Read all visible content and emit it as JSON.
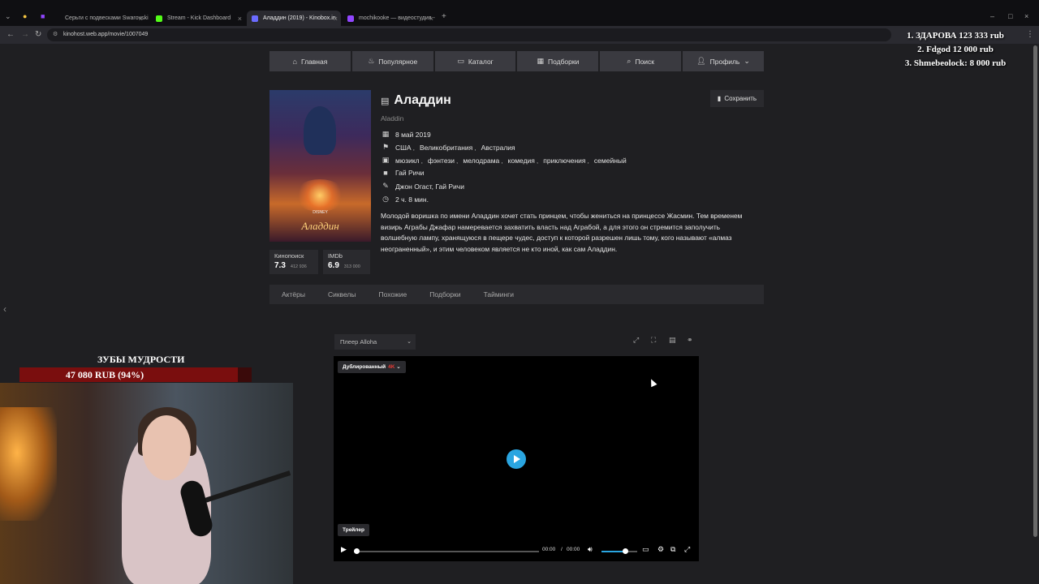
{
  "browser": {
    "tabs": [
      {
        "title": "Серьги с подвесками Swarovski",
        "color": "#4aa3e0",
        "active": false
      },
      {
        "title": "Stream - Kick Dashboard",
        "color": "#53fc18",
        "active": false
      },
      {
        "title": "Аладдин (2019) - Kinobox.in",
        "color": "#6b6bff",
        "active": true
      },
      {
        "title": "mochikooke — видеостудия -",
        "color": "#9146ff",
        "active": false
      }
    ],
    "url": "kinohost.web.app/movie/1007049"
  },
  "nav": {
    "items": [
      {
        "label": "Главная",
        "icon": "home-icon"
      },
      {
        "label": "Популярное",
        "icon": "fire-icon"
      },
      {
        "label": "Каталог",
        "icon": "catalog-icon"
      },
      {
        "label": "Подборки",
        "icon": "collections-icon"
      },
      {
        "label": "Поиск",
        "icon": "search-icon"
      },
      {
        "label": "Профиль",
        "icon": "user-icon"
      }
    ]
  },
  "movie": {
    "title": "Аладдин",
    "original_title": "Aladdin",
    "save_label": "Сохранить",
    "release_date": "8 май 2019",
    "countries": [
      "США",
      "Великобритания",
      "Австралия"
    ],
    "genres": [
      "мюзикл",
      "фэнтези",
      "мелодрама",
      "комедия",
      "приключения",
      "семейный"
    ],
    "director": "Гай Ричи",
    "writers": "Джон Огаст, Гай Ричи",
    "duration": "2 ч. 8 мин.",
    "description": "Молодой воришка по имени Аладдин хочет стать принцем, чтобы жениться на принцессе Жасмин. Тем временем визирь Аграбы Джафар намеревается захватить власть над Аграбой, а для этого он стремится заполучить волшебную лампу, хранящуюся в пещере чудес, доступ к которой разрешен лишь тому, кого называют «алмаз неограненный», и этим человеком является не кто иной, как сам Аладдин.",
    "poster_text": "Аладдин",
    "poster_brand": "DISNEY",
    "ratings": [
      {
        "name": "Кинопоиск",
        "value": "7.3",
        "votes": "412 936"
      },
      {
        "name": "IMDb",
        "value": "6.9",
        "votes": "313 000"
      }
    ]
  },
  "tabs": [
    "Актёры",
    "Сиквелы",
    "Похожие",
    "Подборки",
    "Тайминги"
  ],
  "player": {
    "select_label": "Плеер Alloha",
    "dub_label": "Дублированный",
    "quality": "4K",
    "trailer_label": "Трейлер",
    "time_current": "00:00",
    "time_total": "00:00",
    "time_sep": "/",
    "volume": 0.65,
    "progress": 0.0
  },
  "overlay": {
    "donors": [
      "1. ЗДАРОВА 123 333 rub",
      "2. Fdgod 12 000 rub",
      "3. Shmebeolock: 8 000 rub"
    ],
    "goal_title": "ЗУБЫ МУДРОСТИ",
    "goal_text": "47 080 RUB (94%)",
    "goal_percent": 0.94
  }
}
